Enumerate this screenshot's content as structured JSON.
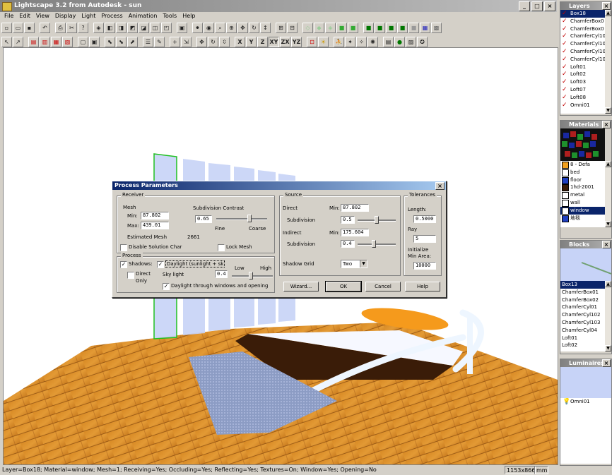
{
  "window": {
    "title": "Lightscape 3.2 from Autodesk - sun"
  },
  "menu": [
    "File",
    "Edit",
    "View",
    "Display",
    "Light",
    "Process",
    "Animation",
    "Tools",
    "Help"
  ],
  "toolbar_axes": [
    "X",
    "Y",
    "Z",
    "XY",
    "ZX",
    "YZ"
  ],
  "status": {
    "text": "Layer=Box18; Material=window; Mesh=1; Receiving=Yes; Occluding=Yes; Reflecting=Yes; Textures=On; Window=Yes; Opening=No",
    "dims": "1153x866",
    "unit": "mm"
  },
  "layers": {
    "title": "Layers",
    "items": [
      "Box18",
      "ChamferBox0",
      "ChamferBox0",
      "ChamferCyl10",
      "ChamferCyl10",
      "ChamferCyl10",
      "ChamferCyl10",
      "Loft01",
      "Loft02",
      "Loft03",
      "Loft07",
      "Loft08",
      "Omni01"
    ]
  },
  "materials": {
    "title": "Materials",
    "items": [
      "8 - Defa",
      "bed",
      "floor",
      "1hd-2001",
      "metal",
      "wall",
      "window",
      "地毯"
    ],
    "selected": "window"
  },
  "blocks": {
    "title": "Blocks",
    "items": [
      "Box13",
      "ChamferBox01",
      "ChamferBox02",
      "ChamferCyl01",
      "ChamferCyl102",
      "ChamferCyl103",
      "ChamferCyl04",
      "Loft01",
      "Loft02"
    ]
  },
  "luminaires": {
    "title": "Luminaires",
    "items": [
      "Omni01"
    ]
  },
  "dialog": {
    "title": "Process Parameters",
    "receiver": {
      "label": "Receiver",
      "mesh_label": "Mesh",
      "min_label": "Min:",
      "min_value": "87.802",
      "max_label": "Max:",
      "max_value": "439.01",
      "subdiv_label": "Subdivision Contrast",
      "subdiv_value": "0.65",
      "fine": "Fine",
      "coarse": "Coarse",
      "estimated_label": "Estimated Mesh",
      "estimated_value": "2661",
      "disable_label": "Disable Solution Char",
      "lock_label": "Lock Mesh"
    },
    "source": {
      "label": "Source",
      "direct_label": "Direct",
      "direct_min_label": "Min:",
      "direct_min": "87.802",
      "subdiv1_label": "Subdivision",
      "subdiv1": "0.5",
      "indirect_label": "Indirect",
      "indirect_min_label": "Min:",
      "indirect_min": "175.604",
      "subdiv2_label": "Subdivision",
      "subdiv2": "0.4",
      "shadow_grid_label": "Shadow Grid",
      "shadow_grid_value": "Two"
    },
    "tolerances": {
      "label": "Tolerances",
      "length_label": "Length:",
      "length_value": "0.5000",
      "ray_label": "Ray",
      "ray_value": "5",
      "init_label_1": "Initialize",
      "init_label_2": "Min Area:",
      "init_value": "10000"
    },
    "process": {
      "label": "Process",
      "shadows": "Shadows:",
      "daylight": "Daylight (sunlight + sk",
      "direct_only_1": "Direct",
      "direct_only_2": "Only",
      "sky_light": "Sky light",
      "sky_value": "0.4",
      "low": "Low",
      "high": "High",
      "through": "Daylight through windows and opening"
    },
    "buttons": {
      "wizard": "Wizard...",
      "ok": "OK",
      "cancel": "Cancel",
      "help": "Help"
    }
  }
}
